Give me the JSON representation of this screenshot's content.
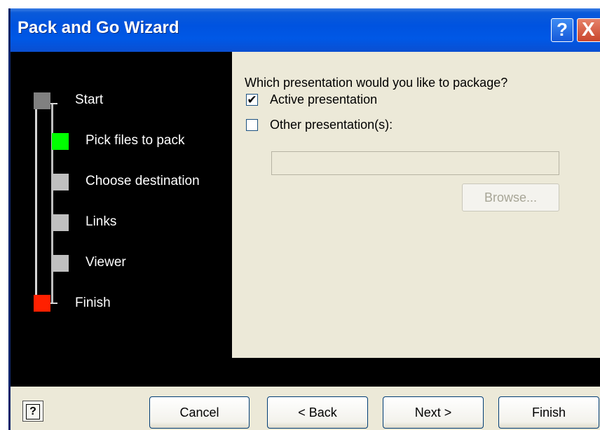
{
  "window": {
    "title": "Pack and Go Wizard",
    "help_glyph": "?",
    "close_glyph": "X"
  },
  "roadmap": {
    "steps": [
      {
        "label": "Start",
        "color": "#808080"
      },
      {
        "label": "Pick files to pack",
        "color": "#00ff00"
      },
      {
        "label": "Choose destination",
        "color": "#c0c0c0"
      },
      {
        "label": "Links",
        "color": "#c0c0c0"
      },
      {
        "label": "Viewer",
        "color": "#c0c0c0"
      },
      {
        "label": "Finish",
        "color": "#ff2000"
      }
    ]
  },
  "content": {
    "question": "Which presentation would you like to package?",
    "active_checked_mark": "✔",
    "active_label": "Active presentation",
    "other_label": "Other presentation(s):",
    "path_value": "",
    "browse_label": "Browse..."
  },
  "footer": {
    "help_icon": "?",
    "cancel_label": "Cancel",
    "back_label": "< Back",
    "next_label": "Next >",
    "finish_label": "Finish"
  }
}
